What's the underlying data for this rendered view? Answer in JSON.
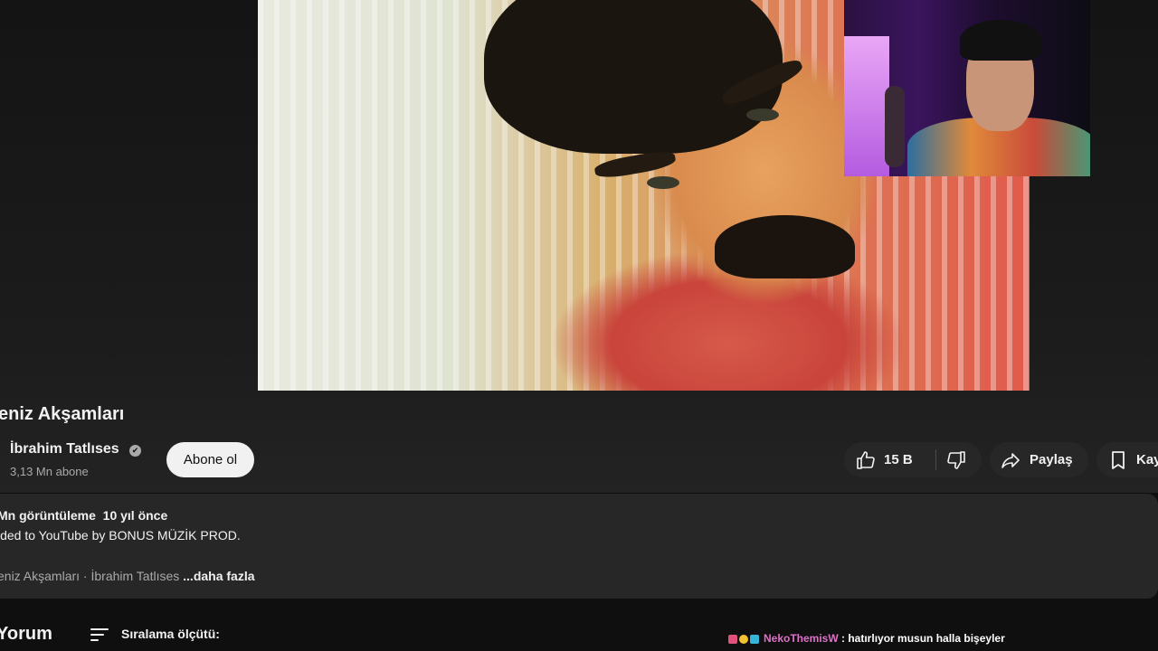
{
  "video": {
    "title": "eniz Akşamları",
    "channel_name": "İbrahim Tatlıses",
    "verified_mark": "✔",
    "subscribers": "3,13 Mn abone",
    "subscribe_label": "Abone ol"
  },
  "actions": {
    "like_count": "15 B",
    "share_label": "Paylaş",
    "save_label": "Kay"
  },
  "description": {
    "stats": "Mn görüntüleme  10 yıl önce",
    "line2": "ided to YouTube by BONUS MÜZİK PROD.",
    "line3": "eniz Akşamları · İbrahim Tatlıses",
    "more": " ...daha fazla"
  },
  "comments": {
    "title": "Yorum",
    "sort_label": "Sıralama ölçütü:"
  },
  "chat": {
    "user": "NekoThemisW",
    "message": " : hatırlıyor musun halla bişeyler",
    "user_color": "#e070c8"
  },
  "colors": {
    "background": "#0f0f0f",
    "pill": "#272727",
    "subscribe_bg": "#f1f1f1"
  }
}
